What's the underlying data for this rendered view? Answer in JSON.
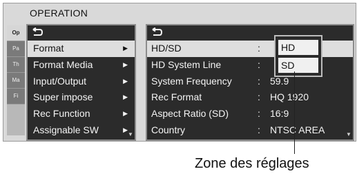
{
  "screen": {
    "title": "OPERATION"
  },
  "side_tabs": [
    "Op",
    "Pa",
    "Th",
    "Ma",
    "Fi"
  ],
  "menu": {
    "items": [
      {
        "label": "Format"
      },
      {
        "label": "Format Media"
      },
      {
        "label": "Input/Output"
      },
      {
        "label": "Super impose"
      },
      {
        "label": "Rec Function"
      },
      {
        "label": "Assignable SW"
      }
    ]
  },
  "settings": {
    "rows": [
      {
        "label": "HD/SD",
        "value": ""
      },
      {
        "label": "HD System Line",
        "value": ""
      },
      {
        "label": "System Frequency",
        "value": "59.9"
      },
      {
        "label": "Rec Format",
        "value": "HQ 1920"
      },
      {
        "label": "Aspect Ratio (SD)",
        "value": "16:9"
      },
      {
        "label": "Country",
        "value": "NTSC AREA"
      }
    ]
  },
  "popup": {
    "options": [
      "HD",
      "SD"
    ]
  },
  "caption": "Zone des réglages"
}
